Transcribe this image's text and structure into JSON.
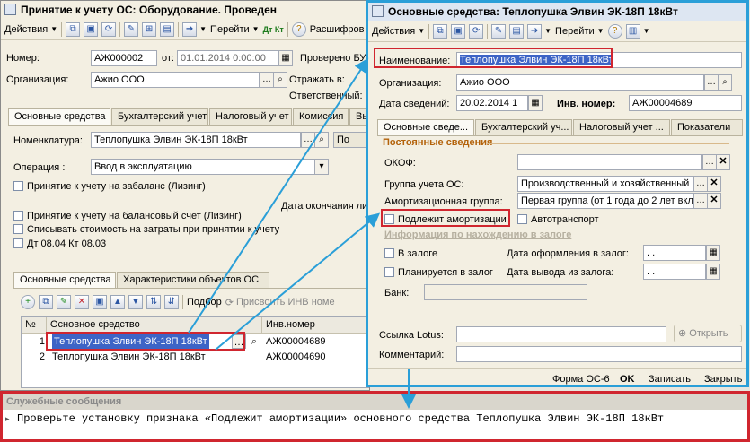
{
  "left_window": {
    "title": "Принятие к учету ОС: Оборудование. Проведен",
    "toolbar": {
      "actions": "Действия",
      "goto": "Перейти",
      "dt_kt": "Дт Кт",
      "expand": "Расшифров"
    },
    "number_label": "Номер:",
    "number_value": "АЖ000002",
    "from_label": "от:",
    "date_value": "01.01.2014  0:00:00",
    "checked_bu": "Проверено БУ",
    "org_label": "Организация:",
    "org_value": "Ажио ООО",
    "reflect_label": "Отражать в:",
    "responsible_label": "Ответственный:",
    "tabs": [
      "Основные средства",
      "Бухгалтерский учет",
      "Налоговый учет",
      "Комиссия",
      "Вы"
    ],
    "nomenclature_label": "Номенклатура:",
    "nomenclature_value": "Теплопушка Элвин ЭК-18П 18кВт",
    "nomenclature_btn": "По",
    "operation_label": "Операция :",
    "operation_value": "Ввод в эксплуатацию",
    "check_offbalance": "Принятие к учету на забаланс (Лизинг)",
    "end_date_label": "Дата окончания ли",
    "check_balance": "Принятие к учету на балансовый счет (Лизинг)",
    "check_writeoff": "Списывать стоимость на затраты при принятии к учету",
    "check_dtkt": "Дт 08.04 Кт 08.03",
    "subtabs": [
      "Основные средства",
      "Характеристики объектов ОС"
    ],
    "grid_toolbar": {
      "selection": "Подбор",
      "assign": "Присвоить ИНВ номе"
    },
    "grid_headers": {
      "num": "№",
      "asset": "Основное средство",
      "inv": "Инв.номер"
    },
    "rows": [
      {
        "n": "1",
        "asset": "Теплопушка Элвин ЭК-18П 18кВт",
        "inv": "АЖ00004689"
      },
      {
        "n": "2",
        "asset": "Теплопушка Элвин ЭК-18П 18кВт",
        "inv": "АЖ00004690"
      }
    ]
  },
  "right_window": {
    "title": "Основные средства: Теплопушка Элвин ЭК-18П 18кВт",
    "toolbar": {
      "actions": "Действия",
      "goto": "Перейти"
    },
    "name_label": "Наименование:",
    "name_value": "Теплопушка Элвин ЭК-18П 18кВт",
    "org_label": "Организация:",
    "org_value": "Ажио ООО",
    "date_label": "Дата сведений:",
    "date_value": "20.02.2014 1",
    "inv_label": "Инв. номер:",
    "inv_value": "АЖ00004689",
    "tabs": [
      "Основные сведе...",
      "Бухгалтерский уч...",
      "Налоговый учет ...",
      "Показатели"
    ],
    "section_permanent": "Постоянные сведения",
    "okof_label": "ОКОФ:",
    "group_label": "Группа учета ОС:",
    "group_value": "Производственный и хозяйственный",
    "amort_label": "Амортизационная группа:",
    "amort_value": "Первая группа (от 1 года до 2 лет вкл",
    "check_amort": "Подлежит амортизации",
    "check_auto": "Автотранспорт",
    "section_pledge": "Информация по нахождению в залоге",
    "check_pledged": "В залоге",
    "pledge_date_label": "Дата оформления в залог:",
    "pledge_date_value": ". .",
    "check_planned": "Планируется в залог",
    "release_date_label": "Дата вывода из залога:",
    "release_date_value": ". .",
    "bank_label": "Банк:",
    "lotus_label": "Ссылка Lotus:",
    "open_btn": "Открыть",
    "comment_label": "Комментарий:",
    "footer": {
      "form": "Форма ОС-6",
      "ok": "OK",
      "save": "Записать",
      "close": "Закрыть"
    }
  },
  "messages": {
    "title": "Служебные сообщения",
    "text": "Проверьте установку признака «Подлежит амортизации» основного средства Теплопушка Элвин ЭК-18П 18кВт"
  },
  "colors": {
    "highlight_red": "#d0262f",
    "arrow_blue": "#2a9fd8",
    "selection_blue": "#3d64c6"
  }
}
